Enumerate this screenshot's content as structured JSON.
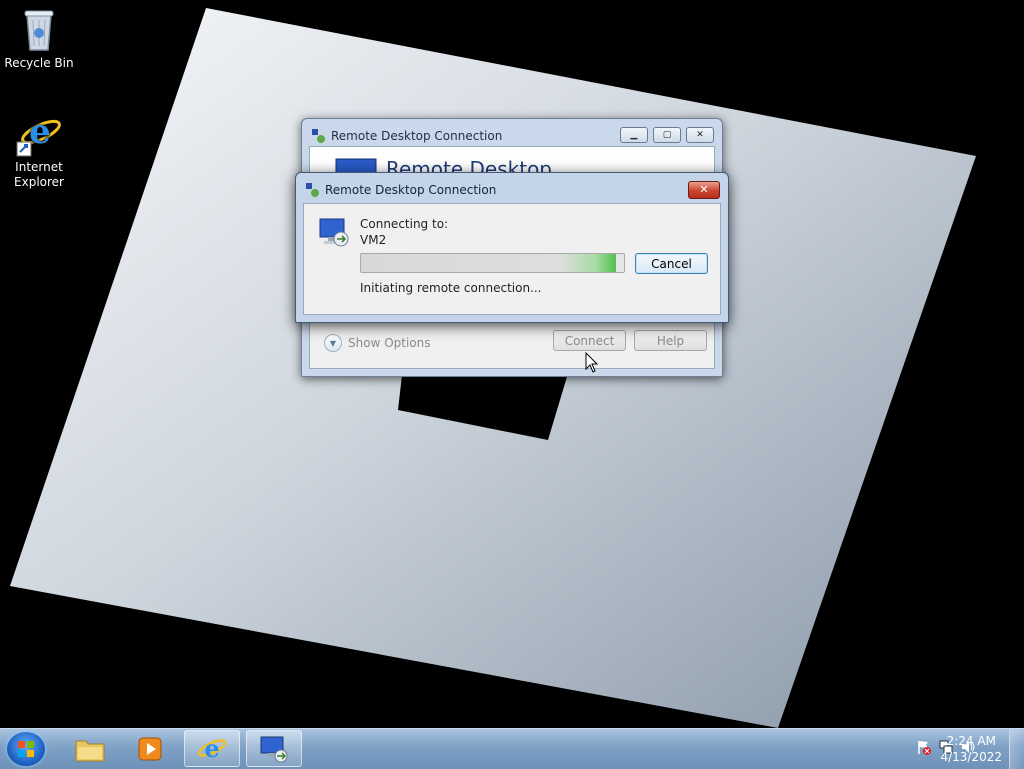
{
  "desktop": {
    "icons": [
      {
        "label": "Recycle Bin",
        "icon": "recycle-bin-icon"
      },
      {
        "label": "Internet\nExplorer",
        "icon": "internet-explorer-icon"
      }
    ]
  },
  "background_window": {
    "title": "Remote Desktop Connection",
    "banner": "Remote Desktop",
    "show_options": "Show Options",
    "connect_label": "Connect",
    "help_label": "Help"
  },
  "dialog": {
    "title": "Remote Desktop Connection",
    "connecting_to": "Connecting to:",
    "host": "VM2",
    "progress_fraction": 0.97,
    "cancel_label": "Cancel",
    "status": "Initiating remote connection...",
    "close_glyph": "✕"
  },
  "taskbar": {
    "start_icon": "windows-start-icon",
    "pinned": [
      "file-explorer-icon",
      "media-player-icon",
      "internet-explorer-icon",
      "remote-desktop-icon"
    ],
    "tray_icons": [
      "action-center-flag-icon",
      "network-icon",
      "volume-icon"
    ],
    "clock": {
      "time": "2:24 AM",
      "date": "4/13/2022"
    }
  },
  "colors": {
    "taskbar": "#7fa1c6",
    "dialog_frame": "#c4d5ea",
    "close_button": "#c8452e",
    "progress_green": "#4fbf4f"
  }
}
